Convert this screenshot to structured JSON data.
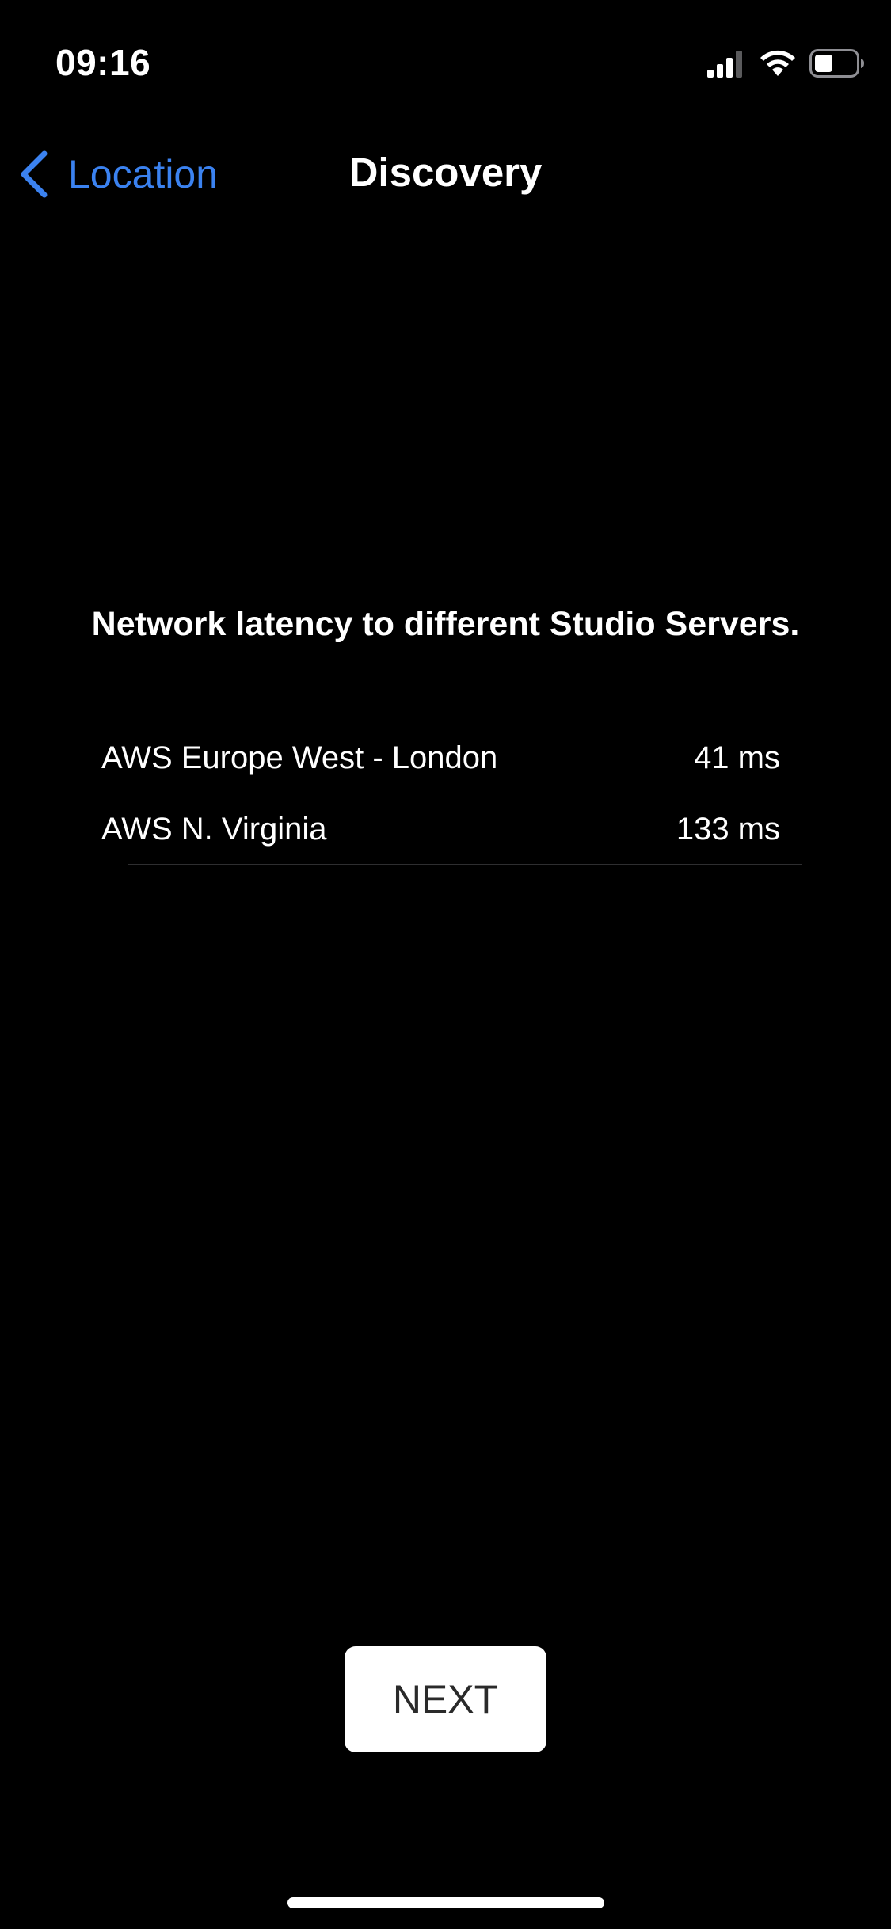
{
  "status_bar": {
    "time": "09:16",
    "icons": [
      "signal-icon",
      "wifi-icon",
      "battery-icon"
    ]
  },
  "nav": {
    "back_label": "Location",
    "title": "Discovery",
    "back_icon": "chevron-left-icon"
  },
  "content": {
    "heading": "Network latency to different Studio Servers.",
    "servers": [
      {
        "name": "AWS Europe West - London",
        "latency": "41 ms"
      },
      {
        "name": "AWS N. Virginia",
        "latency": "133 ms"
      }
    ]
  },
  "actions": {
    "next_label": "NEXT"
  },
  "colors": {
    "background": "#000000",
    "accent": "#3B82F0",
    "text": "#FFFFFF",
    "button_background": "#FFFFFF",
    "button_text": "#2A2A2A",
    "separator": "#2E2E30"
  }
}
